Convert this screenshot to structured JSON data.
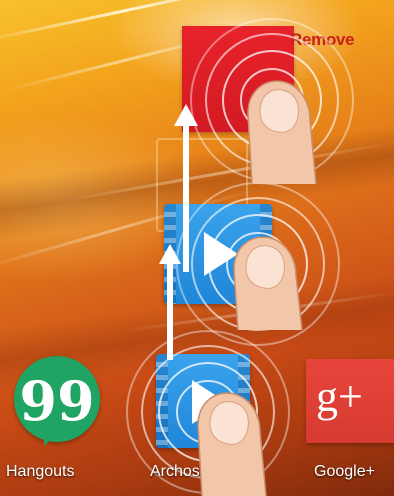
{
  "drop_target": {
    "label": "Remove",
    "color": "#c9201a"
  },
  "dragged_icon": {
    "app": "Archos",
    "color": "#1f86d8"
  },
  "removed_icon_preview": {
    "color": "#e8222a"
  },
  "dock": {
    "apps": [
      {
        "label": "Hangouts",
        "icon": "hangouts-icon",
        "color": "#1fa463",
        "glyph": "99"
      },
      {
        "label": "Archos",
        "icon": "archos-video-icon",
        "color": "#1f86d8"
      },
      {
        "label": "Google+",
        "icon": "google-plus-icon",
        "color": "#e8453c",
        "glyph": "g+"
      }
    ]
  },
  "gesture": {
    "type": "drag-up-to-remove",
    "icon": "finger-touch-icon"
  }
}
